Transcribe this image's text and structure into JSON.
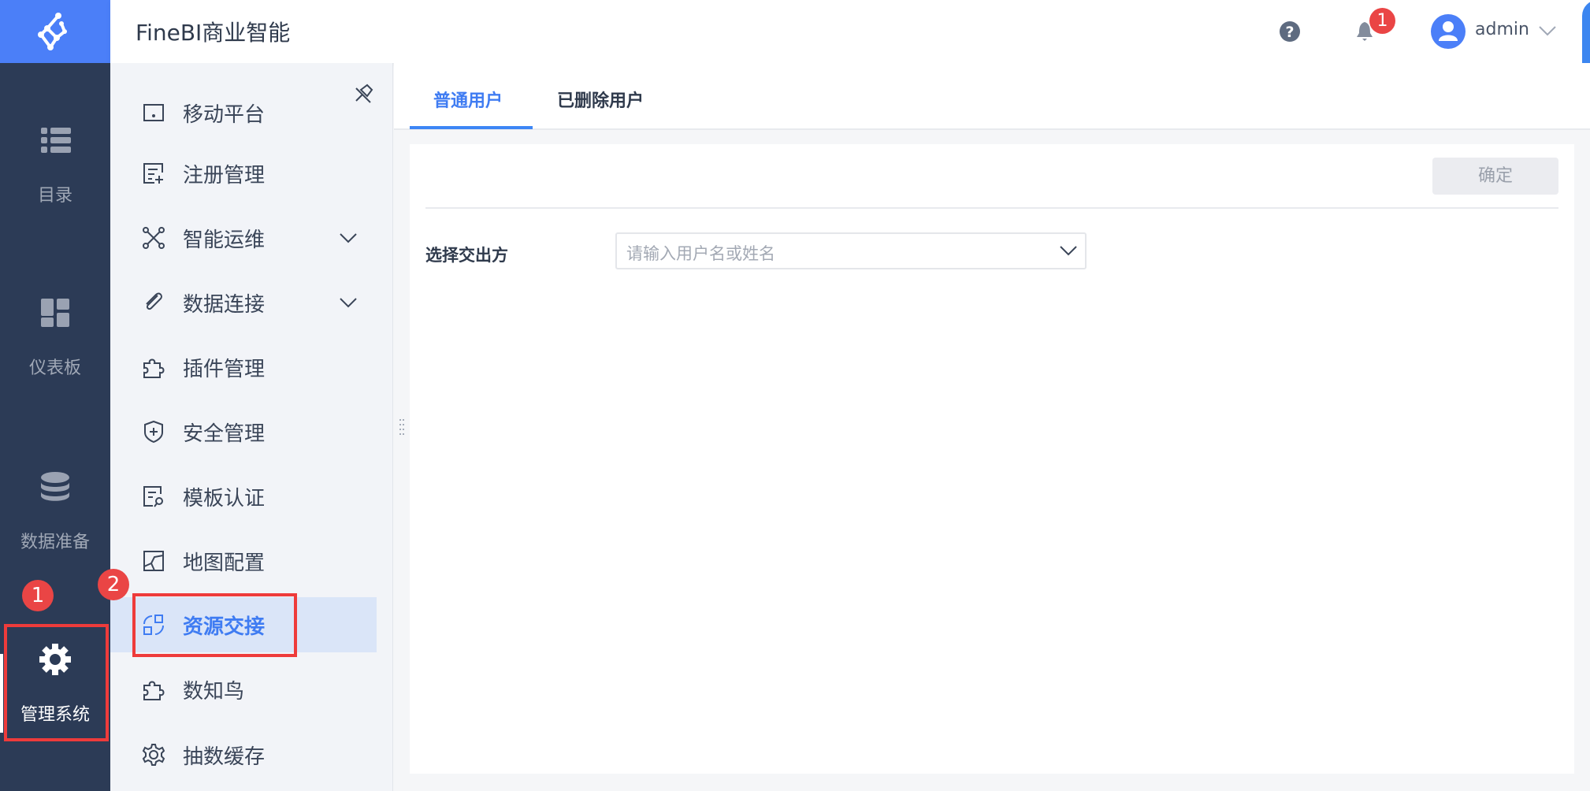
{
  "header": {
    "title": "FineBI商业智能",
    "user": "admin",
    "notification_count": "1"
  },
  "rail": {
    "items": [
      {
        "label": "目录",
        "icon": "catalog-list-icon"
      },
      {
        "label": "仪表板",
        "icon": "dashboard-icon"
      },
      {
        "label": "数据准备",
        "icon": "database-icon"
      },
      {
        "label": "管理系统",
        "icon": "gear-icon",
        "active": true
      }
    ]
  },
  "sidebar": {
    "items": [
      {
        "label": "移动平台"
      },
      {
        "label": "注册管理"
      },
      {
        "label": "智能运维",
        "expandable": true
      },
      {
        "label": "数据连接",
        "expandable": true
      },
      {
        "label": "插件管理"
      },
      {
        "label": "安全管理"
      },
      {
        "label": "模板认证"
      },
      {
        "label": "地图配置"
      },
      {
        "label": "资源交接",
        "active": true
      },
      {
        "label": "数知鸟"
      },
      {
        "label": "抽数缓存"
      }
    ]
  },
  "tabs": [
    {
      "label": "普通用户",
      "active": true
    },
    {
      "label": "已删除用户"
    }
  ],
  "form": {
    "confirm_label": "确定",
    "field_label": "选择交出方",
    "select_placeholder": "请输入用户名或姓名"
  },
  "annotations": {
    "step1": "1",
    "step2": "2"
  },
  "colors": {
    "accent": "#3f7cf2",
    "rail": "#2c3b56",
    "annotation": "#ea4545"
  }
}
